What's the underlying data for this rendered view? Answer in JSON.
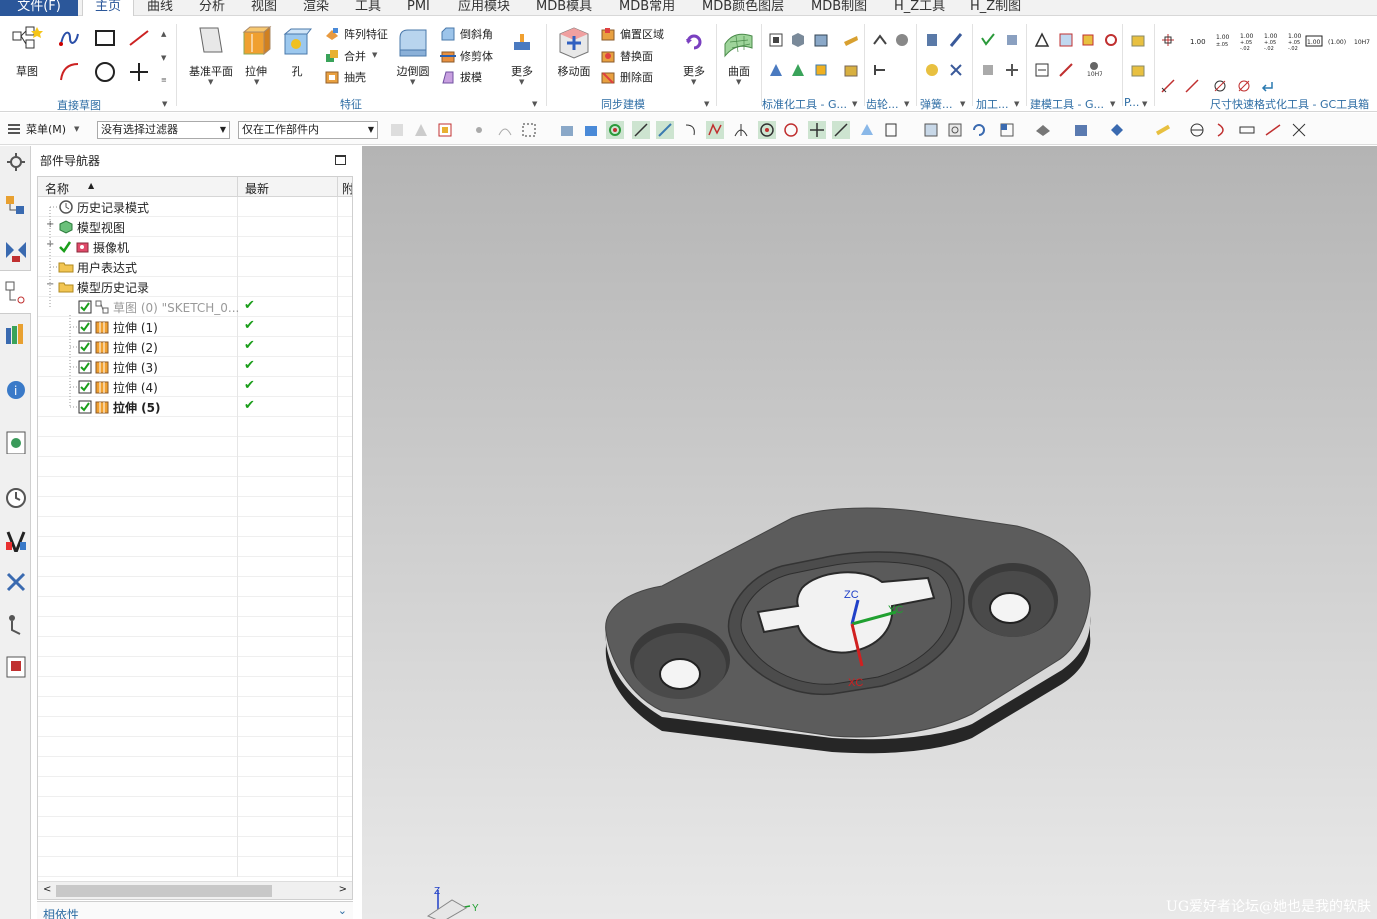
{
  "menu_tabs": [
    "文件(F)",
    "主页",
    "曲线",
    "分析",
    "视图",
    "渲染",
    "工具",
    "PMI",
    "应用模块",
    "MDB模具",
    "MDB常用",
    "MDB颜色图层",
    "MDB制图",
    "H_Z工具",
    "H_Z制图"
  ],
  "active_tab": "主页",
  "ribbon": {
    "direct_sketch": {
      "sketch": "草图",
      "group": "直接草图"
    },
    "feature": {
      "datum_plane": "基准平面",
      "extrude": "拉伸",
      "hole": "孔",
      "pattern": "阵列特征",
      "unite": "合并",
      "shell": "抽壳",
      "edge_blend": "边倒圆",
      "chamfer": "倒斜角",
      "trim_body": "修剪体",
      "draft": "拔模",
      "more": "更多",
      "group": "特征"
    },
    "sync": {
      "move_face": "移动面",
      "offset_region": "偏置区域",
      "replace_face": "替换面",
      "delete_face": "删除面",
      "more": "更多",
      "group": "同步建模"
    },
    "surface": {
      "label": "曲面"
    },
    "groups_more": [
      "标准化工具 - G...",
      "齿轮...",
      "弹簧...",
      "加工...",
      "建模工具 - G...",
      "P...",
      "尺寸快速格式化工具 - GC工具箱"
    ],
    "dim_labels": [
      "1.00",
      "1.00\n±.05",
      "1.00\n+.05\n-.02",
      "1.00\n+.05\n-.02",
      "1.00\n+.05\n-.02",
      "1.00",
      "(1.00)",
      "10H7"
    ]
  },
  "toolbar2": {
    "menu": "菜单(M)",
    "filter": "没有选择过滤器",
    "scope": "仅在工作部件内"
  },
  "navigator": {
    "title": "部件导航器",
    "columns": [
      "名称",
      "最新",
      "附"
    ],
    "items": [
      {
        "label": "历史记录模式",
        "latest": ""
      },
      {
        "label": "模型视图",
        "latest": ""
      },
      {
        "label": "摄像机",
        "latest": ""
      },
      {
        "label": "用户表达式",
        "latest": ""
      },
      {
        "label": "模型历史记录",
        "latest": ""
      },
      {
        "label": "草图 (0) \"SKETCH_0...",
        "latest": "✔"
      },
      {
        "label": "拉伸 (1)",
        "latest": "✔"
      },
      {
        "label": "拉伸 (2)",
        "latest": "✔"
      },
      {
        "label": "拉伸 (3)",
        "latest": "✔"
      },
      {
        "label": "拉伸 (4)",
        "latest": "✔"
      },
      {
        "label": "拉伸 (5)",
        "latest": "✔"
      }
    ],
    "bottom_label": "相依性"
  },
  "viewport": {
    "axes": {
      "zc": "ZC",
      "yc": "YC",
      "xc": "XC"
    },
    "triad": {
      "z": "Z",
      "y": "Y"
    }
  },
  "watermark": "UG爱好者论坛@她也是我的软肤",
  "colors": {
    "accent": "#2b579a",
    "group_label": "#2e6da4",
    "check": "#1a9e1a",
    "part_top": "#5a5a5a",
    "part_side": "#2a2a2a"
  }
}
